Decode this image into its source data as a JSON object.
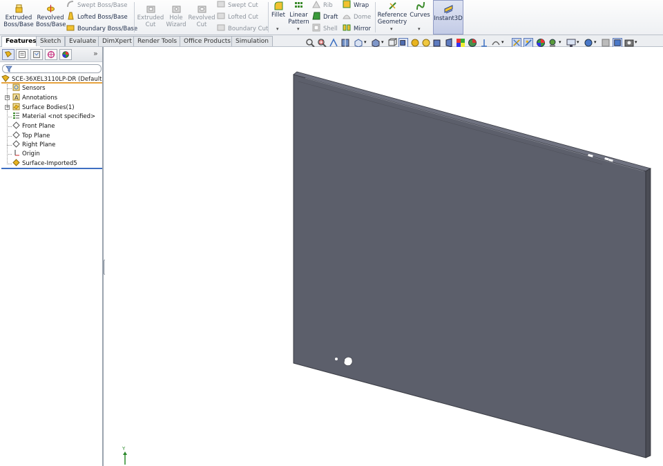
{
  "ribbon": {
    "extruded_boss": "Extruded Boss/Base",
    "revolved_boss": "Revolved Boss/Base",
    "swept_boss": "Swept Boss/Base",
    "lofted_boss": "Lofted Boss/Base",
    "boundary_boss": "Boundary Boss/Base",
    "extruded_cut": "Extruded Cut",
    "hole_wizard": "Hole Wizard",
    "revolved_cut": "Revolved Cut",
    "swept_cut": "Swept Cut",
    "lofted_cut": "Lofted Cut",
    "boundary_cut": "Boundary Cut",
    "fillet": "Fillet",
    "linear_pattern": "Linear Pattern",
    "rib": "Rib",
    "draft": "Draft",
    "shell": "Shell",
    "wrap": "Wrap",
    "dome": "Dome",
    "mirror": "Mirror",
    "reference_geometry": "Reference Geometry",
    "curves": "Curves",
    "instant3d": "Instant3D"
  },
  "tabs": [
    "Features",
    "Sketch",
    "Evaluate",
    "DimXpert",
    "Render Tools",
    "Office Products",
    "Simulation"
  ],
  "tree": {
    "root": "SCE-36XEL3110LP-DR  (Default<",
    "items": [
      "Sensors",
      "Annotations",
      "Surface Bodies(1)",
      "Material <not specified>",
      "Front Plane",
      "Top Plane",
      "Right Plane",
      "Origin",
      "Surface-Imported5"
    ]
  },
  "viewport": {
    "triad_label": "Y"
  },
  "icons": {
    "extruded_boss": "extrude-icon",
    "revolved_boss": "revolve-icon",
    "fillet": "fillet-icon",
    "linear_pattern": "pattern-icon",
    "draft": "draft-icon",
    "wrap": "wrap-icon",
    "mirror": "mirror-icon",
    "reference_geometry": "reference-geometry-icon",
    "curves": "curves-icon",
    "instant3d": "instant3d-icon"
  },
  "colors": {
    "model_face": "#5c5f6b",
    "model_edge": "#3a3c44",
    "accent": "#3e6ec2"
  }
}
